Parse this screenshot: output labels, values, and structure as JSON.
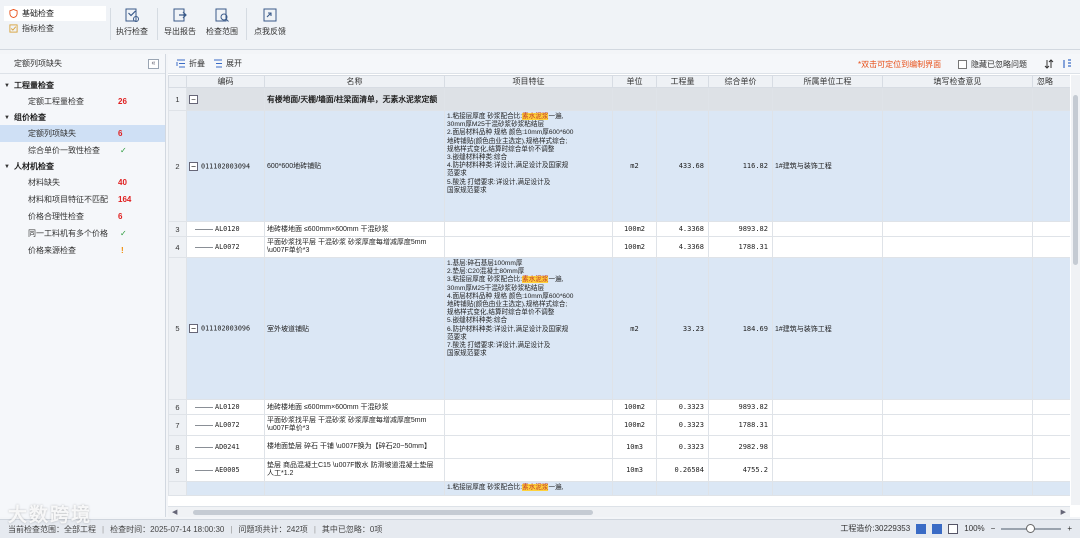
{
  "toolbar": {
    "modes": [
      "基础检查",
      "指标检查"
    ],
    "buttons": [
      "执行检查",
      "导出报告",
      "检查范围",
      "点我反馈"
    ]
  },
  "left_panel": {
    "header": "定额列项缺失",
    "collapse_glyph": "«",
    "groups": [
      {
        "label": "工程量检查",
        "items": [
          {
            "label": "定额工程量检查",
            "count": "26",
            "kind": "count"
          }
        ]
      },
      {
        "label": "组价检查",
        "items": [
          {
            "label": "定额列项缺失",
            "count": "6",
            "kind": "count",
            "selected": true
          },
          {
            "label": "综合单价一致性检查",
            "count": "✓",
            "kind": "ok"
          }
        ]
      },
      {
        "label": "人材机检查",
        "items": [
          {
            "label": "材料缺失",
            "count": "40",
            "kind": "count"
          },
          {
            "label": "材料和项目特征不匹配",
            "count": "164",
            "kind": "count"
          },
          {
            "label": "价格合理性检查",
            "count": "6",
            "kind": "count"
          },
          {
            "label": "同一工料机有多个价格",
            "count": "✓",
            "kind": "ok"
          },
          {
            "label": "价格来源检查",
            "count": "!",
            "kind": "warn"
          }
        ]
      }
    ]
  },
  "main_toolbar": {
    "fold": "折叠",
    "expand": "展开",
    "hint": "*双击可定位到编制界面",
    "hide_ignored": "隐藏已忽略问题"
  },
  "table": {
    "columns": [
      "",
      "编码",
      "名称",
      "项目特征",
      "单位",
      "工程量",
      "综合单价",
      "所属单位工程",
      "填写检查意见",
      "忽略"
    ],
    "rows": [
      {
        "no": "1",
        "style": "grey",
        "node": "root",
        "code": "",
        "name": "有楼地面/天棚/墙面/柱梁面清单，无素水泥浆定额",
        "feature": "",
        "unit": "",
        "qty": "",
        "price": "",
        "project": ""
      },
      {
        "no": "2",
        "style": "blue",
        "node": "bill",
        "code": "011102003094",
        "name": "600*600地砖铺贴",
        "feature_pre": "1.粘接层厚度 砂浆配合比:",
        "feature_hl": "素水泥浆",
        "feature_post": "一遍,\n30mm厚M25干混砂浆砂浆粘结层\n2.面层材料品种 规格 颜色:10mm厚600*600\n地砖铺贴(颜色由业主选定),规格样式综合;\n规格样式变化,结算时综合单价不调整\n3.嵌缝材料种类:综合\n4.防护材料种类:详设计,满足设计及国家规\n范要求\n5.酸洗 打蜡要求:详设计,满足设计及\n国家规范要求",
        "unit": "m2",
        "qty": "433.68",
        "price": "116.82",
        "project": "1#建筑与装饰工程"
      },
      {
        "no": "3",
        "style": "",
        "node": "quota",
        "code": "AL0120",
        "name": "地砖楼地面 ≤600mm×600mm 干混砂浆",
        "feature": "",
        "unit": "100m2",
        "qty": "4.3368",
        "price": "9893.82",
        "project": ""
      },
      {
        "no": "4",
        "style": "",
        "node": "quota",
        "code": "AL0072",
        "name": "平面砂浆找平层 干混砂浆 砂浆厚度每增减厚度5mm \\u007F单价*3",
        "feature": "",
        "unit": "100m2",
        "qty": "4.3368",
        "price": "1788.31",
        "project": ""
      },
      {
        "no": "5",
        "style": "blue",
        "node": "bill",
        "code": "011102003096",
        "name": "室外坡道铺贴",
        "feature_pre": "1.基层:碎石基层100mm厚\n2.垫层:C20混凝土80mm厚\n3.粘接层厚度 砂浆配合比:",
        "feature_hl": "素水泥浆",
        "feature_post": "一遍,\n30mm厚M25干混砂浆砂浆粘结层\n4.面层材料品种 规格 颜色:10mm厚600*600\n地砖铺贴(颜色由业主选定),规格样式综合;\n规格样式变化,结算时综合单价不调整\n5.嵌缝材料种类:综合\n6.防护材料种类:详设计,满足设计及国家规\n范要求\n7.酸洗 打蜡要求:详设计,满足设计及\n国家规范要求",
        "unit": "m2",
        "qty": "33.23",
        "price": "184.69",
        "project": "1#建筑与装饰工程"
      },
      {
        "no": "6",
        "style": "",
        "node": "quota",
        "code": "AL0120",
        "name": "地砖楼地面 ≤600mm×600mm 干混砂浆",
        "feature": "",
        "unit": "100m2",
        "qty": "0.3323",
        "price": "9893.82",
        "project": ""
      },
      {
        "no": "7",
        "style": "",
        "node": "quota",
        "code": "AL0072",
        "name": "平面砂浆找平层 干混砂浆 砂浆厚度每增减厚度5mm \\u007F单价*3",
        "feature": "",
        "unit": "100m2",
        "qty": "0.3323",
        "price": "1788.31",
        "project": ""
      },
      {
        "no": "8",
        "style": "",
        "node": "quota",
        "code": "AD0241",
        "name": "楼地面垫层 碎石 干铺 \\u007F换为【碎石20~50mm】",
        "feature": "",
        "unit": "10m3",
        "qty": "0.3323",
        "price": "2982.98",
        "project": ""
      },
      {
        "no": "9",
        "style": "",
        "node": "quota",
        "code": "AE0005",
        "name": "垫层 商品混凝土C15 \\u007F散水 防滑坡道混凝土垫层 人工*1.2",
        "feature": "",
        "unit": "10m3",
        "qty": "0.26584",
        "price": "4755.2",
        "project": ""
      },
      {
        "no": "",
        "style": "blue",
        "node": "partial",
        "code": "",
        "name": "",
        "feature_pre": "1.粘接层厚度 砂浆配合比:",
        "feature_hl": "素水泥浆",
        "feature_post": "一遍,",
        "unit": "",
        "qty": "",
        "price": "",
        "project": ""
      }
    ]
  },
  "status": {
    "scope": "当前检查范围：全部工程",
    "time": "检查时间：2025-07-14 18:00:30",
    "total": "问题项共计：242项",
    "ignored": "其中已忽略：0项",
    "cost": "工程造价:30229353",
    "zoom": "100%"
  },
  "watermark": "大数跨境",
  "colors": {
    "accent": "#3a6bc5",
    "error": "#e02020",
    "ok": "#2a9a3a",
    "warn": "#f08a00",
    "highlight": "#ffd23c",
    "selected_row": "#dbe7f5"
  }
}
